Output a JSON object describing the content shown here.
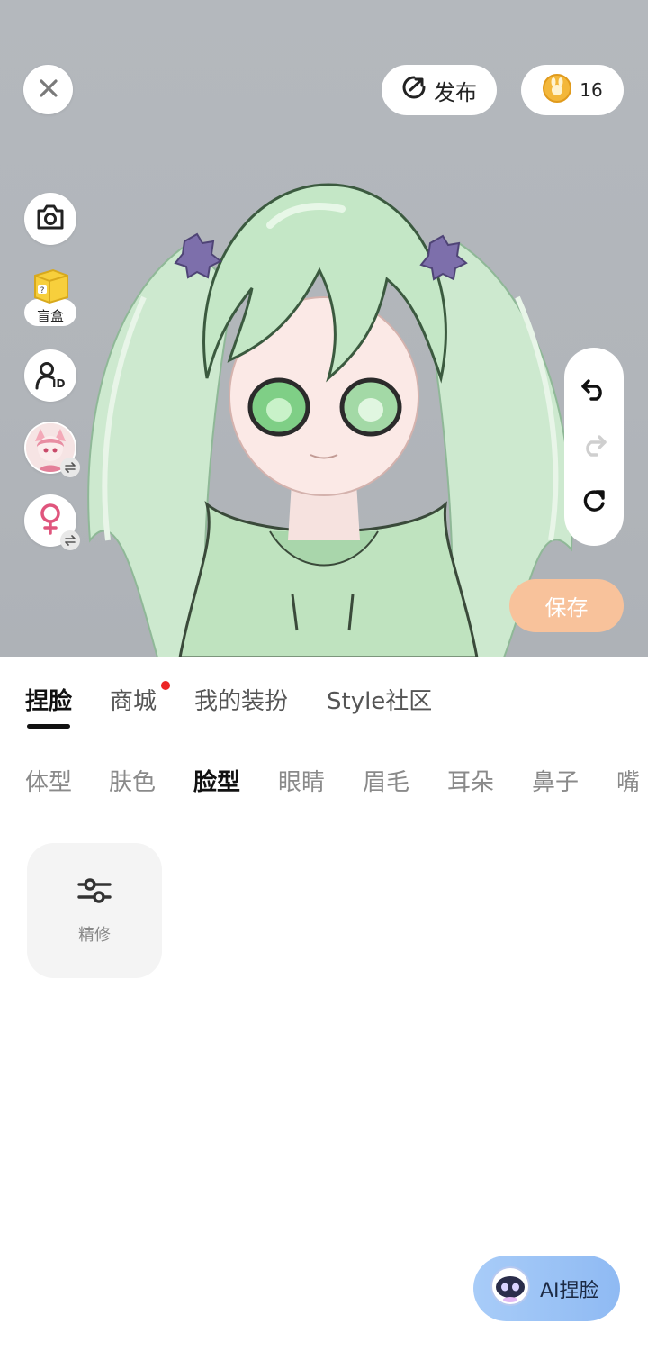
{
  "topbar": {
    "close_icon": "close-icon",
    "publish_label": "发布",
    "coin_count": "16"
  },
  "side_tools": {
    "camera_icon": "camera-icon",
    "blindbox_label": "盲盒",
    "id_label": "ID",
    "gender_icon": "female-icon"
  },
  "history": {
    "undo_icon": "undo-icon",
    "redo_icon": "redo-icon",
    "reset_icon": "reset-icon"
  },
  "save_label": "保存",
  "tabs": [
    {
      "label": "捏脸",
      "active": true
    },
    {
      "label": "商城",
      "active": false,
      "badge": true
    },
    {
      "label": "我的装扮",
      "active": false
    },
    {
      "label": "Style社区",
      "active": false
    }
  ],
  "subtabs": [
    {
      "label": "体型"
    },
    {
      "label": "肤色"
    },
    {
      "label": "脸型",
      "active": true
    },
    {
      "label": "眼睛"
    },
    {
      "label": "眉毛"
    },
    {
      "label": "耳朵"
    },
    {
      "label": "鼻子"
    },
    {
      "label": "嘴"
    }
  ],
  "option_card": {
    "label": "精修",
    "icon": "sliders-icon"
  },
  "ai_button": {
    "label": "AI捏脸"
  },
  "colors": {
    "accent_save": "#f8c29b",
    "tab_badge": "#ec2525",
    "ai_gradient_start": "#a8ccf8",
    "ai_gradient_end": "#8fbaf3"
  }
}
